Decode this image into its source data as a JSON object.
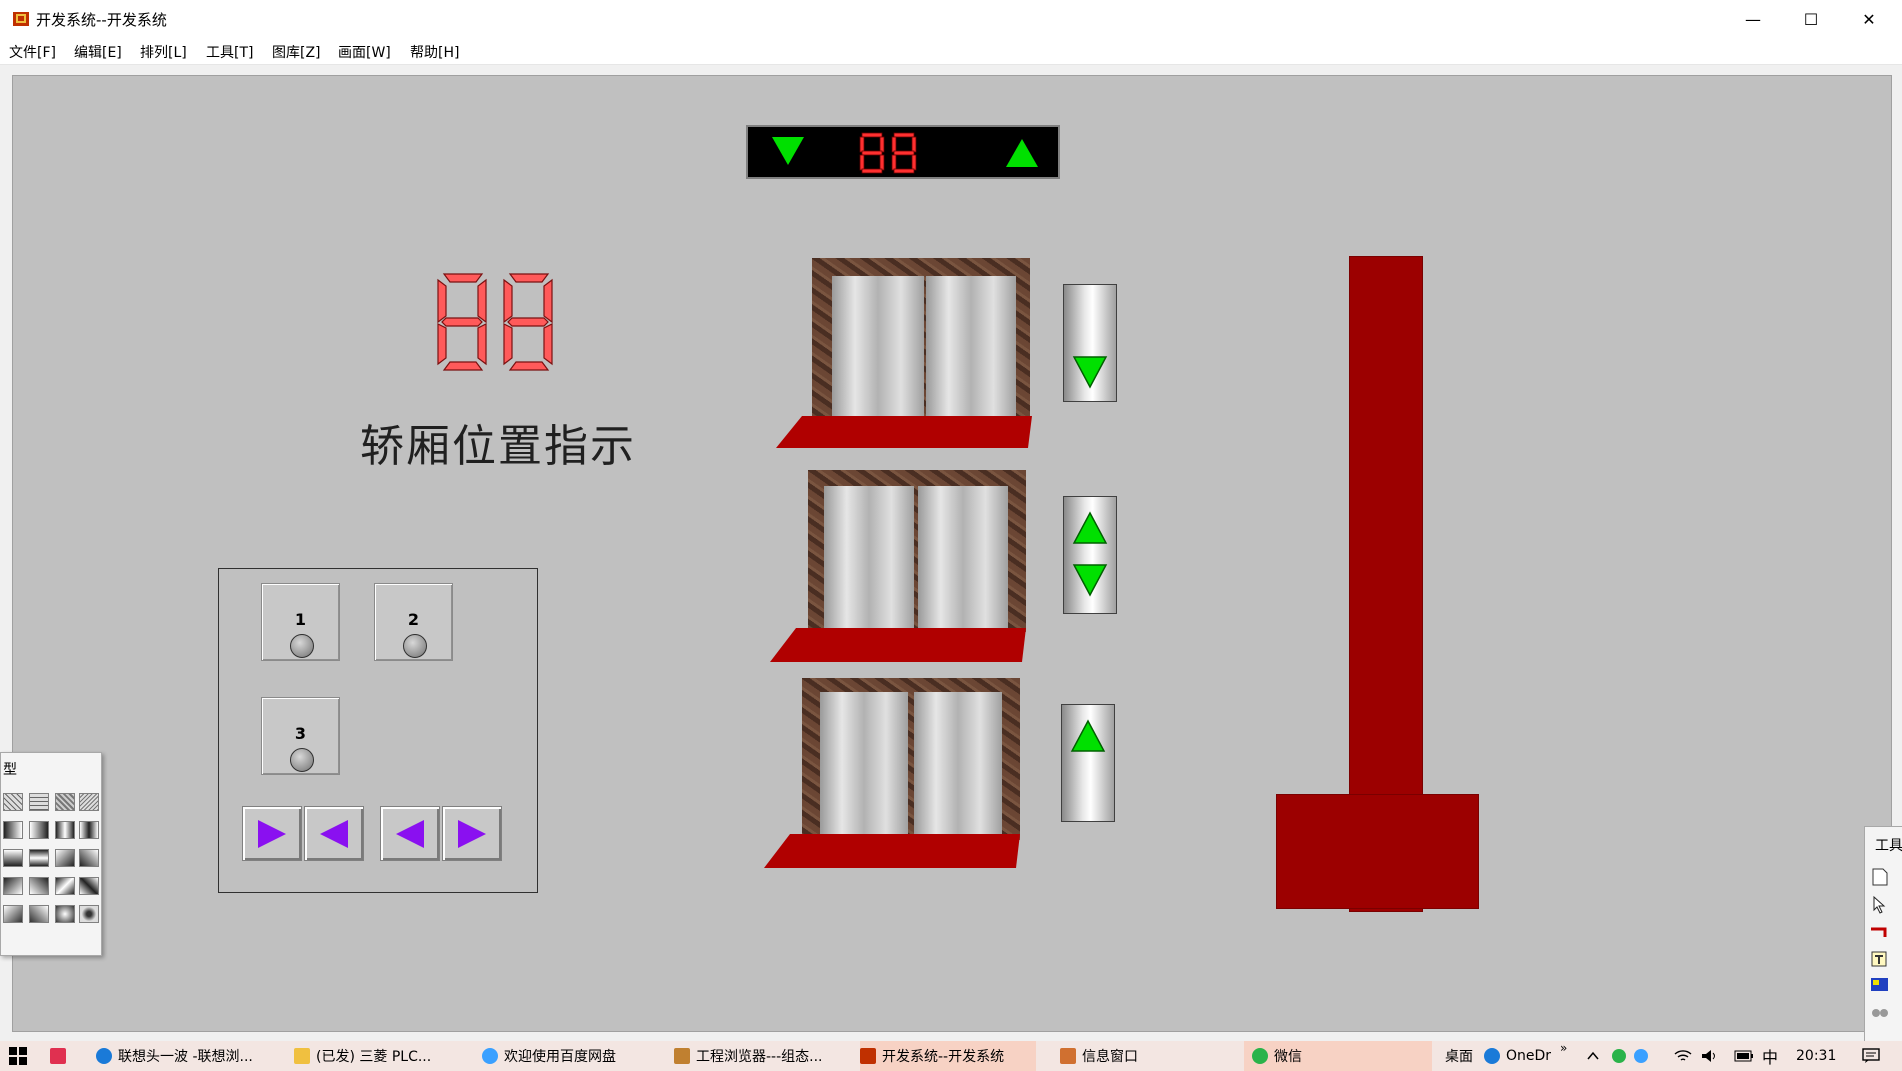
{
  "window": {
    "title": "开发系统--开发系统",
    "minimize_glyph": "—",
    "maximize_glyph": "☐",
    "close_glyph": "✕"
  },
  "menu": [
    "文件[F]",
    "编辑[E]",
    "排列[L]",
    "工具[T]",
    "图库[Z]",
    "画面[W]",
    "帮助[H]"
  ],
  "canvas": {
    "top_indicator": {
      "digits": "88",
      "down_arrow_color": "#00e000",
      "up_arrow_color": "#00e000",
      "digit_color": "#ff3030"
    },
    "big_display": {
      "digits": "88",
      "digit_color": "#ff5a5a"
    },
    "caption": "轿厢位置指示",
    "floor_buttons": [
      {
        "label": "1"
      },
      {
        "label": "2"
      },
      {
        "label": "3"
      }
    ],
    "door_buttons": [
      {
        "direction": "right"
      },
      {
        "direction": "left"
      },
      {
        "direction": "left"
      },
      {
        "direction": "right"
      }
    ],
    "call_boxes": [
      {
        "floor": "top",
        "arrows": [
          "down"
        ]
      },
      {
        "floor": "middle",
        "arrows": [
          "up",
          "down"
        ]
      },
      {
        "floor": "bottom",
        "arrows": [
          "up"
        ]
      }
    ],
    "colors": {
      "mat": "#b00000",
      "shaft": "#9c0000",
      "arrow_green": "#00e000",
      "arrow_purple": "#8a10f0"
    }
  },
  "palette": {
    "title": "型"
  },
  "toolbox": {
    "title": "工具"
  },
  "taskbar": {
    "items": [
      "联想头一波 -联想浏...",
      "(已发) 三菱 PLC...",
      "欢迎使用百度网盘",
      "工程浏览器---组态...",
      "开发系统--开发系统",
      "信息窗口",
      "微信"
    ],
    "desktop_label": "桌面",
    "onedrive_label": "OneDr",
    "more": "»",
    "ime": "中",
    "time": "20:31"
  }
}
